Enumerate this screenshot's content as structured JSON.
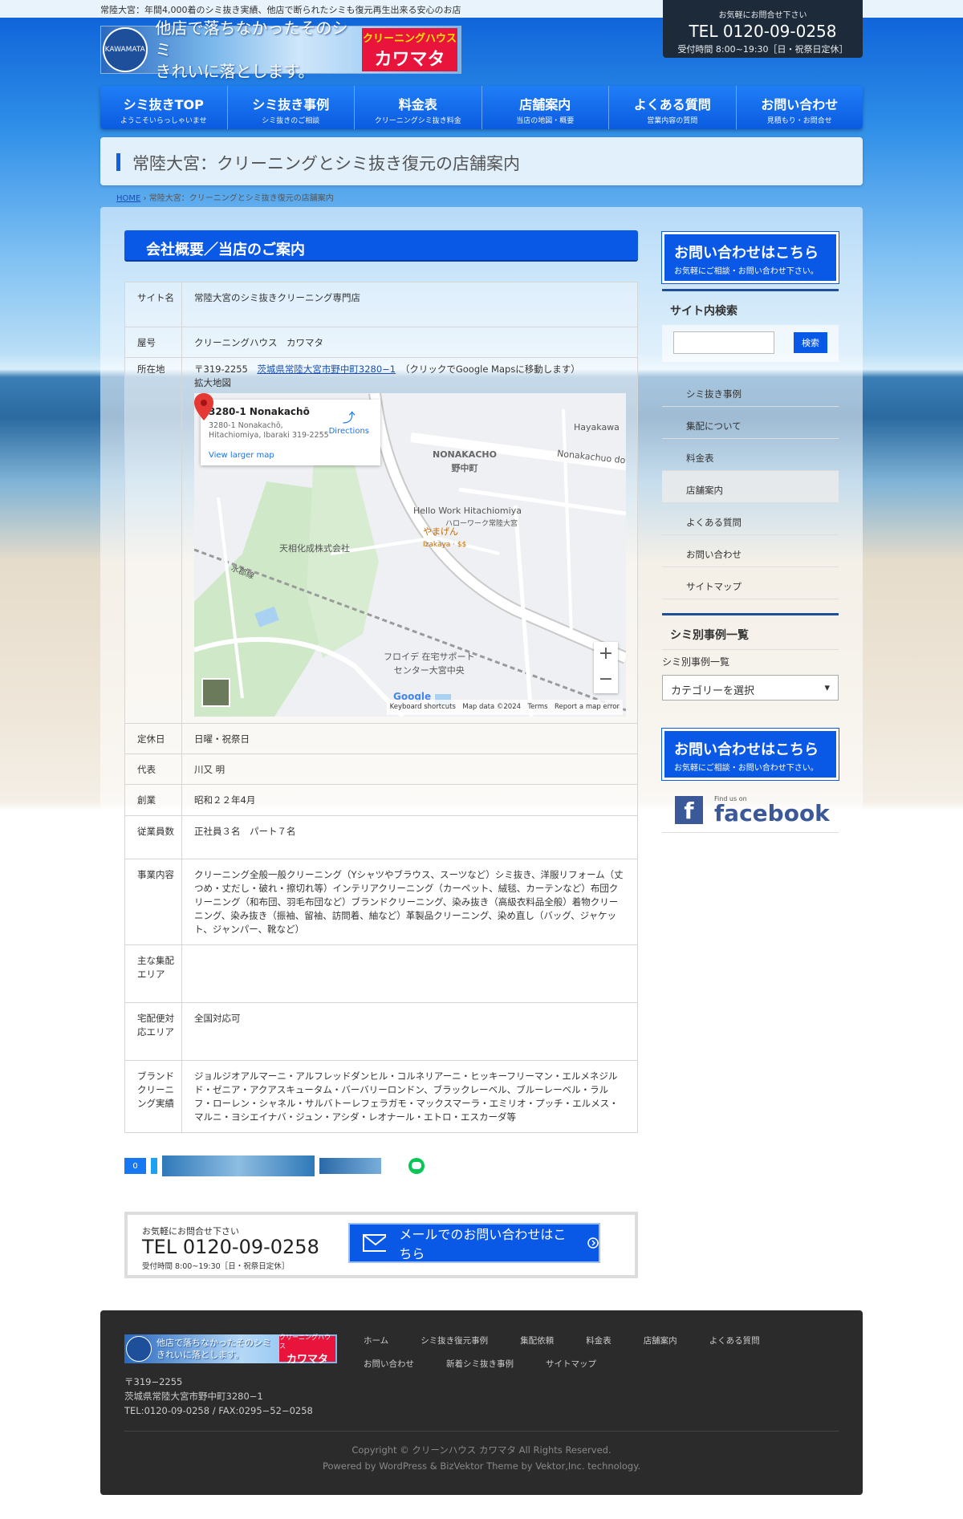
{
  "topbar": {
    "tagline": "常陸大宮：年間4,000着のシミ抜き実績、他店で断られたシミも復元再生出来る安心のお店"
  },
  "header_tel": {
    "small": "お気軽にお問合せ下さい",
    "tel": "TEL 0120-09-0258",
    "hours": "受付時間 8:00~19:30［日・祝祭日定休］"
  },
  "logo": {
    "emblem": "KAWAMATA",
    "line1": "他店で落ちなかったそのシミ",
    "line2": "きれいに落とします。",
    "brand_top": "クリーニングハウス",
    "brand_main": "カワマタ"
  },
  "nav": [
    {
      "main": "シミ抜きTOP",
      "sub": "ようこそいらっしゃいませ"
    },
    {
      "main": "シミ抜き事例",
      "sub": "シミ抜きのご相談"
    },
    {
      "main": "料金表",
      "sub": "クリーニングシミ抜き料金"
    },
    {
      "main": "店舗案内",
      "sub": "当店の地図・概要"
    },
    {
      "main": "よくある質問",
      "sub": "営業内容の質問"
    },
    {
      "main": "お問い合わせ",
      "sub": "見積もり・お問合せ"
    }
  ],
  "page_title": "常陸大宮：クリーニングとシミ抜き復元の店舗案内",
  "breadcrumb": {
    "home": "HOME",
    "sep": "›",
    "current": "常陸大宮：クリーニングとシミ抜き復元の店舗案内"
  },
  "section_title": "会社概要／当店のご案内",
  "info": {
    "site_k": "サイト名",
    "site_v": "常陸大宮のシミ抜きクリーニング専門店",
    "shop_k": "屋号",
    "shop_v": "クリーニングハウス　カワマタ",
    "addr_k": "所在地",
    "addr_zip": "〒319-2255",
    "addr_link": "茨城県常陸大宮市野中町3280−1",
    "addr_note": "（クリックでGoogle Mapsに移動します）",
    "addr_zoom": "拡大地図",
    "closed_k": "定休日",
    "closed_v": "日曜・祝祭日",
    "rep_k": "代表",
    "rep_v": "川又 明",
    "found_k": "創業",
    "found_v": "昭和２２年4月",
    "staff_k": "従業員数",
    "staff_v": "正社員３名　パート７名",
    "biz_k": "事業内容",
    "biz_v": "クリーニング全般一般クリーニング（Yシャツやブラウス、スーツなど）シミ抜き、洋服リフォーム（丈つめ・丈だし・破れ・擦切れ等）インテリアクリーニング（カーペット、絨毯、カーテンなど）布団クリーニング（和布団、羽毛布団など）ブランドクリーニング、染み抜き（高級衣料品全般）着物クリーニング、染み抜き（振袖、留袖、訪問着、紬など）革製品クリーニング、染め直し（バッグ、ジャケット、ジャンパー、靴など）",
    "area_k": "主な集配エリア",
    "area_v": "",
    "deliv_k": "宅配便対応エリア",
    "deliv_v": "全国対応可",
    "brand_k": "ブランドクリーニング実績",
    "brand_v": "ジョルジオアルマーニ・アルフレッドダンヒル・コルネリアーニ・ヒッキーフリーマン・エルメネジルド・ゼニア・アクアスキュータム・バーバリーロンドン、ブラックレーベル、ブルーレーベル・ラルフ・ローレン・シャネル・サルバトーレフェラガモ・マックスマーラ・エミリオ・プッチ・エルメス・マルニ・ヨシエイナバ・ジュン・アシダ・レオナール・エトロ・エスカーダ等"
  },
  "map": {
    "card_title": "3280-1 Nonakachō",
    "card_addr": "3280-1 Nonakachō, Hitachiomiya, Ibaraki 319-2255",
    "card_link": "View larger map",
    "directions": "Directions",
    "lbl_nonaka": "NONAKACHO",
    "lbl_nonaka_jp": "野中町",
    "lbl_road": "Nonakachuo do",
    "lbl_hayakawa": "Hayakawa",
    "lbl_hellowork": "Hello Work Hitachiomiya",
    "lbl_hellowork_jp": "ハローワーク常陸大宮",
    "lbl_yamagen": "やまげん",
    "lbl_yamagen_en": "Izakaya · $$",
    "lbl_tenso": "天相化成株式会社",
    "lbl_suigun": "水郡線",
    "lbl_floide": "フロイデ 在宅サポート",
    "lbl_floide2": "センター大宮中央",
    "google": "Google",
    "foot": "Keyboard shortcuts　Map data ©2024　Terms　Report a map error"
  },
  "share": {
    "count": "0"
  },
  "contact": {
    "small": "お気軽にお問合せ下さい",
    "tel": "TEL 0120-09-0258",
    "hours": "受付時間 8:00~19:30［日・祝祭日定休］",
    "button": "メールでのお問い合わせはこちら"
  },
  "sidebar": {
    "cta_main": "お問い合わせはこちら",
    "cta_sub": "お気軽にご相談・お問い合わせ下さい。",
    "search_title": "サイト内検索",
    "search_btn": "検索",
    "menu": [
      "シミ抜き事例",
      "集配について",
      "料金表",
      "店舗案内",
      "よくある質問",
      "お問い合わせ",
      "サイトマップ"
    ],
    "cat_title": "シミ別事例一覧",
    "cat_label": "シミ別事例一覧",
    "cat_select": "カテゴリーを選択",
    "fb_small": "Find us on",
    "fb_big": "facebook"
  },
  "footer": {
    "zip": "〒319−2255",
    "addr": "茨城県常陸大宮市野中町3280−1",
    "tel": "TEL:0120-09-0258 / FAX:0295−52−0258",
    "links": [
      "ホーム",
      "シミ抜き復元事例",
      "集配依頼",
      "料金表",
      "店舗案内",
      "よくある質問",
      "お問い合わせ",
      "新着シミ抜き事例",
      "サイトマップ"
    ],
    "copy": "Copyright © クリーンハウス カワマタ All Rights Reserved.",
    "powered": "Powered by WordPress & BizVektor Theme by Vektor,Inc. technology."
  },
  "colors": {
    "accent": "#0a58e6",
    "footer_bg": "#2b2b2b",
    "pin": "#e53935"
  }
}
